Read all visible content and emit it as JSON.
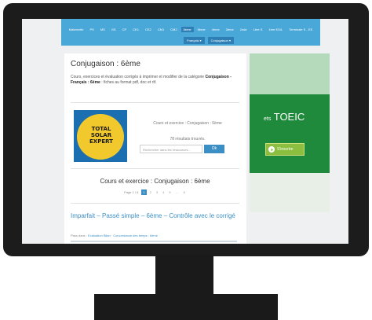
{
  "nav": {
    "items": [
      "Maternelle",
      "PS",
      "MS",
      "GS",
      "CP",
      "CE1",
      "CE2",
      "CM1",
      "CM2",
      "6ème",
      "5ème",
      "4ème",
      "3ème",
      "2nde",
      "1ère S",
      "1ère ES/L",
      "Terminale S - ES"
    ],
    "active_index": 9,
    "dropdowns": [
      "Français ▾",
      "Conjugaison ▾"
    ]
  },
  "main": {
    "title": "Conjugaison : 6ème",
    "description_prefix": "Cours, exercices et évaluation corrigés à imprimer et modifier de la catégorie ",
    "description_bold1": "Conjugaison - Français : 6ème",
    "description_suffix": ": fiches au format pdf, doc et rtf.",
    "ad_logo_text": "TOTAL SOLAR EXPERT",
    "results_title": "Cours et exercice : Conjugaison : 6ème",
    "results_count": "78 résultats trouvés.",
    "search_placeholder": "Rechercher dans les ressources...",
    "ok_label": "Ok",
    "section_title": "Cours et exercice : Conjugaison : 6ème",
    "pagination": {
      "label": "Page 1 / 6",
      "pages": [
        "1",
        "2",
        "3",
        "4",
        "5",
        "…",
        "6"
      ],
      "current": "1"
    },
    "article": {
      "title": "Imparfait – Passé simple – 6ème – Contrôle avec le corrigé",
      "breadcrumb_prefix": "Pass dans :",
      "breadcrumb_link1": "Evaluation Bilan",
      "breadcrumb_link2": "Concordance des temps : 6ème"
    }
  },
  "right_ad": {
    "brand": "ETS TOEIC",
    "brand_small": "ets",
    "brand_main": "TOEIC",
    "signup_label": "S'inscrire"
  },
  "colors": {
    "nav_bg": "#4aa8d8",
    "accent": "#3b8fc4",
    "ad_green": "#1f8a3c",
    "ad_yellow": "#f2c92c"
  }
}
